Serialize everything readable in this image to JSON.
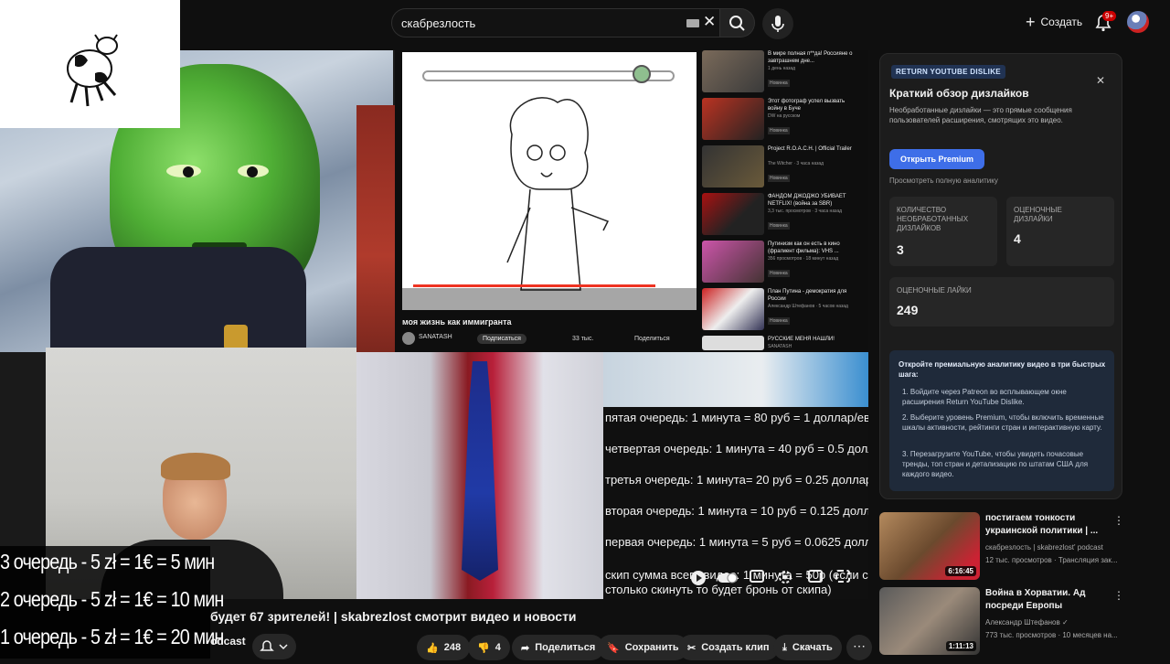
{
  "search": {
    "query": "скабрезлость"
  },
  "header": {
    "create_label": "Создать",
    "notif_count": "9+"
  },
  "inner_video": {
    "title": "моя жизнь как иммигранта",
    "channel": "SANATASH",
    "subscribe": "Подписаться",
    "likes": "33 тыс.",
    "share": "Поделиться",
    "recs": [
      {
        "title": "В мире полная п**да! Россияне о завтрашнем дне...",
        "meta": "1 день назад",
        "tag": "Новинка"
      },
      {
        "title": "Этот фотограф успел вызвать войну в Буче",
        "meta": "DW на русском",
        "tag": "Новинка"
      },
      {
        "title": "Project R.O.A.C.H. | Official Trailer",
        "meta": "The Witcher · 3 часа назад",
        "tag": "Новинка"
      },
      {
        "title": "ФАНДОМ ДЖОДЖО УБИВАЕТ NETFLIX! (война за SBR)",
        "meta": "3,3 тыс. просмотров · 3 часа назад",
        "tag": "Новинка"
      },
      {
        "title": "Путинизм как он есть в кино (фрагмент фильма): VHS ...",
        "meta": "356 просмотров · 18 минут назад",
        "tag": "Новинка"
      },
      {
        "title": "План Путина - демократия для России",
        "meta": "Александр Штефанов · 5 часов назад",
        "tag": "Новинка"
      },
      {
        "title": "РУССКИЕ МЕНЯ НАШЛИ!",
        "meta": "SANATASH",
        "tag": ""
      }
    ]
  },
  "queue_lines": [
    "пятая очередь: 1 минута = 80 руб = 1 доллар/евро",
    "четвертая очередь: 1 минута = 40 руб = 0.5 доллара",
    "третья очередь: 1 минута= 20 руб = 0.25 доллара",
    "вторая очередь: 1 минута = 10 руб = 0.125 доллара",
    "первая очередь: 1 минута = 5 руб = 0.0625 доллера",
    "скип сумма всего видео: 1 минута = 50р (если сразу",
    "столько  скинуть то будет бронь от скипа)"
  ],
  "overlay_lines": [
    "3 очередь - 5 zł = 1€ = 5 мин",
    "2 очередь - 5 zł = 1€ = 10 мин",
    "1 очередь - 5 zł = 1€ = 20 мин"
  ],
  "video": {
    "title": "будет 67 зрителей! | skabrezlost смотрит видео и новости",
    "channel_tail": "odcast"
  },
  "actions": {
    "likes": "248",
    "dislikes": "4",
    "share": "Поделиться",
    "save": "Сохранить",
    "clip": "Создать клип",
    "download": "Скачать"
  },
  "rydl": {
    "tag": "RETURN YOUTUBE DISLIKE",
    "title": "Краткий обзор дизлайков",
    "desc": "Необработанные дизлайки — это прямые сообщения пользователей расширения, смотрящих это видео.",
    "premium_btn": "Открыть Premium",
    "full_link": "Просмотреть полную аналитику",
    "raw_label": "КОЛИЧЕСТВО НЕОБРАБОТАННЫХ ДИЗЛАЙКОВ",
    "raw_value": "3",
    "est_label": "ОЦЕНОЧНЫЕ ДИЗЛАЙКИ",
    "est_value": "4",
    "likes_label": "ОЦЕНОЧНЫЕ ЛАЙКИ",
    "likes_value": "249",
    "promo_title": "Откройте премиальную аналитику видео в три быстрых шага:",
    "steps": [
      "Войдите через Patreon во всплывающем окне расширения Return YouTube Dislike.",
      "Выберите уровень Premium, чтобы включить временные шкалы активности, рейтинги стран и интерактивную карту.",
      "Перезагрузите YouTube, чтобы увидеть почасовые тренды, топ стран и детализацию по штатам США для каждого видео."
    ]
  },
  "side_videos": [
    {
      "title": "постигаем тонкости украинской политики | ...",
      "channel": "скабрезлость | skabrezlost' podcast",
      "meta": "12 тыс. просмотров · Трансляция зак...",
      "duration": "6:16:45"
    },
    {
      "title": "Война в Хорватии. Ад посреди Европы",
      "channel": "Александр Штефанов ✓",
      "meta": "773 тыс. просмотров · 10 месяцев на...",
      "duration": "1:11:13"
    }
  ],
  "colors": {
    "accent": "#3e6ee8",
    "badge": "#cc0000"
  }
}
